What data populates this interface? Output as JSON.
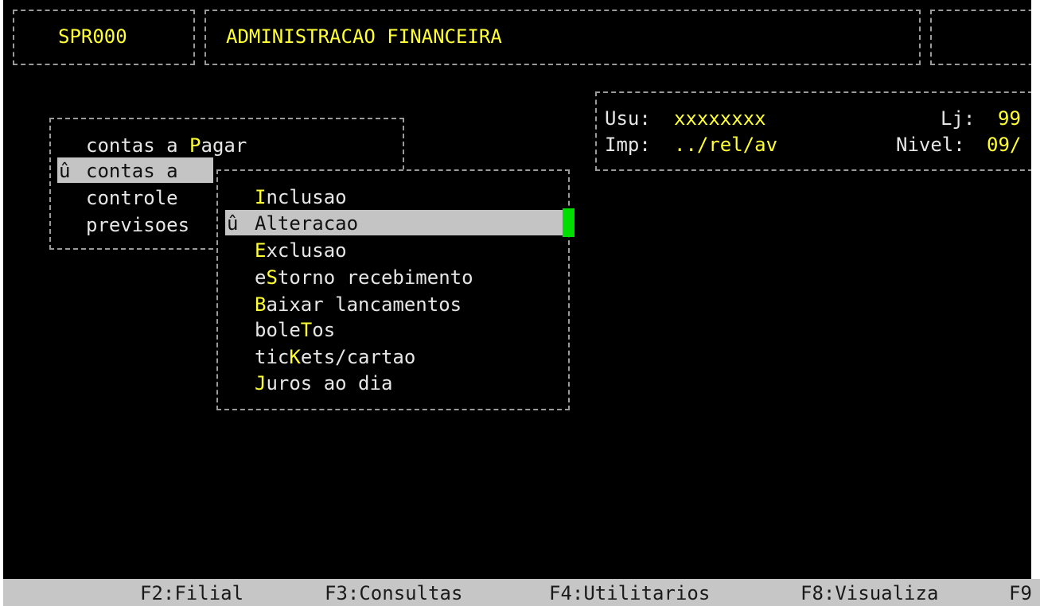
{
  "header": {
    "program_code": "SPR000",
    "title": "ADMINISTRACAO FINANCEIRA"
  },
  "info": {
    "user_label": "Usu:",
    "user_value": "xxxxxxxx",
    "store_label": "Lj:",
    "store_value": "99",
    "printer_label": "Imp:",
    "printer_value": "../rel/av",
    "level_label": "Nivel:",
    "level_value": "09/"
  },
  "main_menu": {
    "selected_marker": "û",
    "items": [
      {
        "pre": "contas a ",
        "key": "P",
        "post": "agar"
      },
      {
        "text": "contas a "
      },
      {
        "text": "controle"
      },
      {
        "text": "previsoes"
      }
    ]
  },
  "submenu": {
    "selected_marker": "û",
    "items": [
      {
        "pre": "",
        "key": "I",
        "post": "nclusao"
      },
      {
        "pre": "",
        "key": "A",
        "post": "lteracao"
      },
      {
        "pre": "",
        "key": "E",
        "post": "xclusao"
      },
      {
        "pre": "e",
        "key": "S",
        "post": "torno recebimento"
      },
      {
        "pre": "",
        "key": "B",
        "post": "aixar lancamentos"
      },
      {
        "pre": "bole",
        "key": "T",
        "post": "os"
      },
      {
        "pre": "tic",
        "key": "K",
        "post": "ets/cartao"
      },
      {
        "pre": "",
        "key": "J",
        "post": "uros ao dia"
      }
    ]
  },
  "status_bar": {
    "keys": [
      "F2:Filial",
      "F3:Consultas",
      "F4:Utilitarios",
      "F8:Visualiza",
      "F9"
    ]
  },
  "colors": {
    "background": "#000000",
    "text": "#e6e6e6",
    "highlight": "#ffff33",
    "selection": "#c4c4c4",
    "cursor": "#00dd00",
    "status_bar": "#c6c6c6"
  }
}
